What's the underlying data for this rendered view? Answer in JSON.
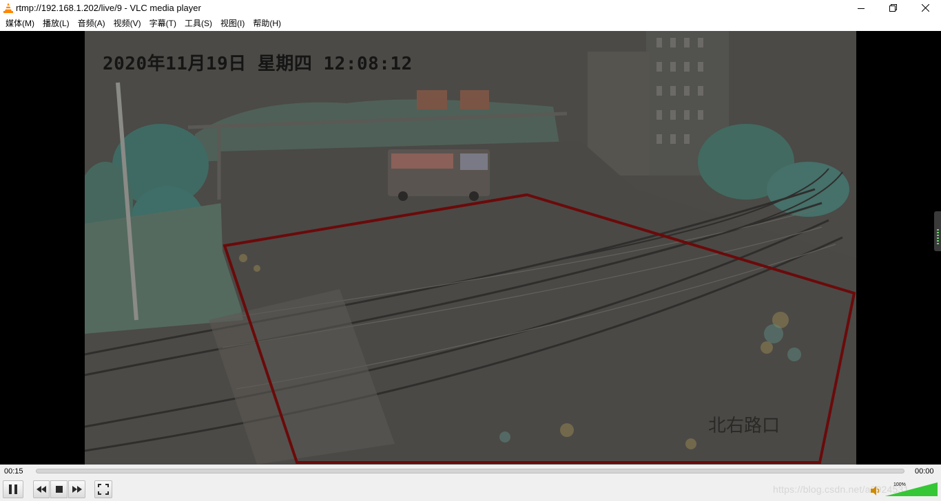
{
  "window": {
    "title": "rtmp://192.168.1.202/live/9 - VLC media player",
    "app_icon": "vlc-cone-icon"
  },
  "menubar": {
    "items": [
      {
        "label": "媒体(M)"
      },
      {
        "label": "播放(L)"
      },
      {
        "label": "音频(A)"
      },
      {
        "label": "视频(V)"
      },
      {
        "label": "字幕(T)"
      },
      {
        "label": "工具(S)"
      },
      {
        "label": "视图(I)"
      },
      {
        "label": "帮助(H)"
      }
    ]
  },
  "video": {
    "osd_timestamp": "2020年11月19日  星期四  12:08:12",
    "osd_location": "北右路口",
    "roi_color": "#6b0a0a"
  },
  "player": {
    "elapsed": "00:15",
    "total": "00:00",
    "volume_percent": "100%",
    "volume_level": 1.0,
    "watermark": "https://blog.csdn.net/a2924531"
  },
  "colors": {
    "accent": "#ff8800",
    "volume_green": "#35c735"
  }
}
